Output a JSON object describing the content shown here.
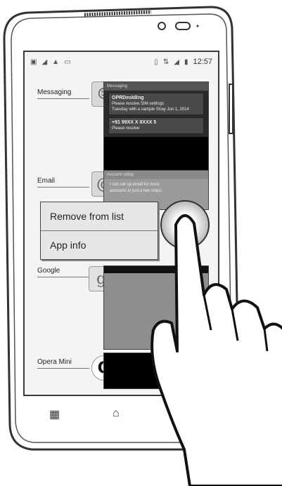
{
  "status_bar": {
    "left_icons": [
      "image-icon",
      "wifi-icon",
      "warning-icon",
      "notification-icon"
    ],
    "right_icons": [
      "vibrate-icon",
      "data-icon",
      "signal-icon",
      "battery-icon"
    ],
    "time": "12:57"
  },
  "recent_apps": [
    {
      "label": "Messaging",
      "icon": "messaging-icon",
      "icon_glyph": "☺"
    },
    {
      "label": "Email",
      "icon": "email-icon",
      "icon_glyph": "@"
    },
    {
      "label": "Google",
      "icon": "google-icon",
      "icon_glyph": "g"
    },
    {
      "label": "Opera Mini",
      "icon": "opera-mini-icon",
      "icon_glyph": "O"
    }
  ],
  "messaging_thumb": {
    "header": "Messaging",
    "cards": [
      {
        "title": "OPRDeskBng",
        "line1": "Please resolve SIM settings",
        "line2": "Tuesday with a sample Stray Jun 1, 2014"
      },
      {
        "title": "+91 99XX X 8XXX 5",
        "line1": "Please resolve",
        "line2": ""
      }
    ]
  },
  "email_thumb": {
    "header": "Account setup",
    "line1": "I can set up email for most",
    "line2": "accounts in just a few steps."
  },
  "context_menu": {
    "items": [
      "Remove from list",
      "App info"
    ]
  },
  "nav": {
    "recent_glyph": "▦",
    "home_glyph": "⌂"
  }
}
